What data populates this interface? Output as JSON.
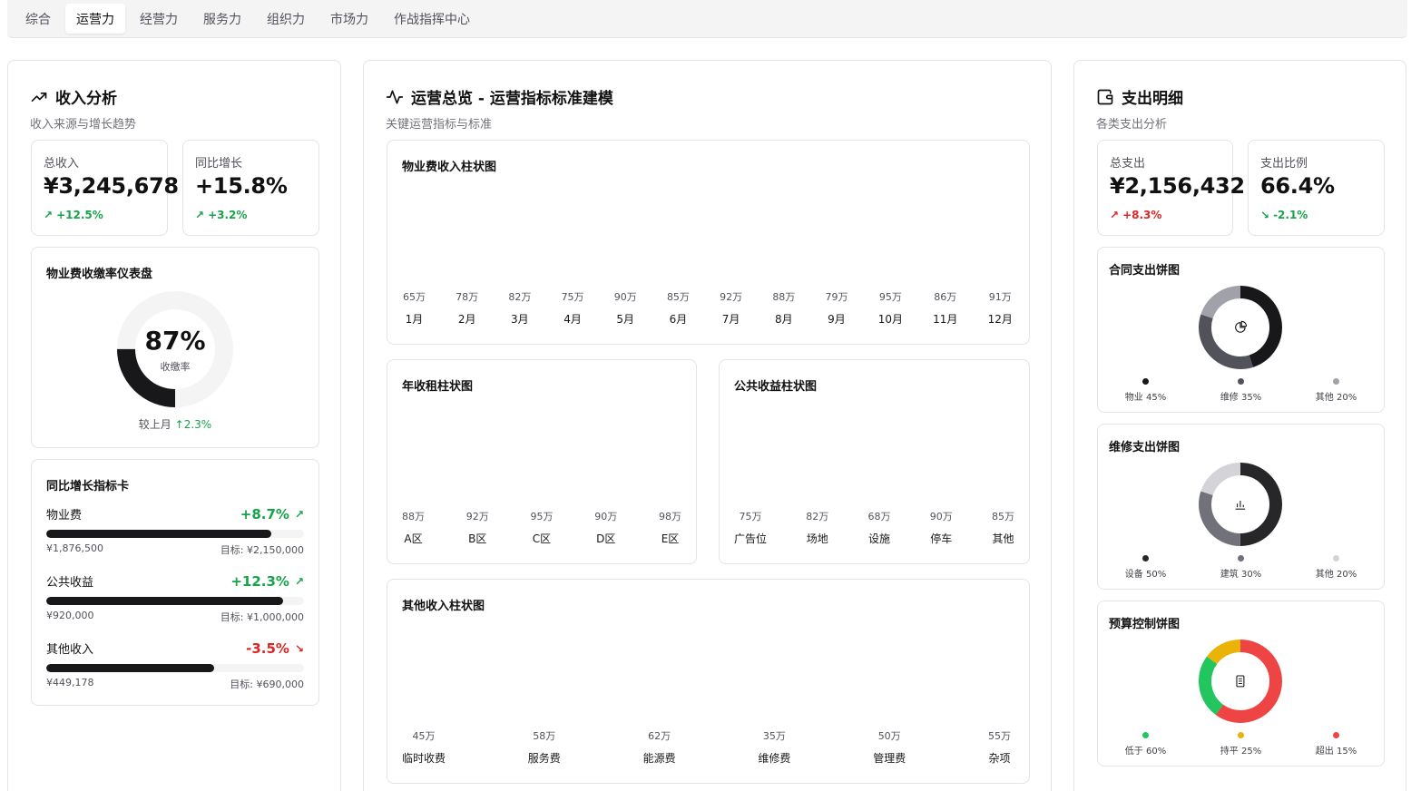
{
  "tabs": [
    "综合",
    "运营力",
    "经营力",
    "服务力",
    "组织力",
    "市场力",
    "作战指挥中心"
  ],
  "active_tab": 1,
  "left": {
    "title": "收入分析",
    "subtitle": "收入来源与增长趋势",
    "total": {
      "label": "总收入",
      "value": "¥3,245,678",
      "delta": "+12.5%"
    },
    "yoy": {
      "label": "同比增长",
      "value": "+15.8%",
      "delta": "+3.2%"
    },
    "gauge": {
      "title": "物业费收缴率仪表盘",
      "value": "87%",
      "label": "收缴率",
      "value_fraction": 0.87,
      "foot_prefix": "较上月",
      "foot_delta": "↑2.3%"
    },
    "growth": {
      "title": "同比增长指标卡",
      "items": [
        {
          "name": "物业费",
          "pct": "+8.7%",
          "dir": "up",
          "actual": "¥1,876,500",
          "target": "目标: ¥2,150,000",
          "ratio": 0.873
        },
        {
          "name": "公共收益",
          "pct": "+12.3%",
          "dir": "up",
          "actual": "¥920,000",
          "target": "目标: ¥1,000,000",
          "ratio": 0.92
        },
        {
          "name": "其他收入",
          "pct": "-3.5%",
          "dir": "down",
          "actual": "¥449,178",
          "target": "目标: ¥690,000",
          "ratio": 0.651
        }
      ]
    }
  },
  "mid": {
    "title": "运营总览 - 运营指标标准建模",
    "subtitle": "关键运营指标与标准",
    "charts": {
      "property": {
        "title": "物业费收入柱状图",
        "values": [
          "65万",
          "78万",
          "82万",
          "75万",
          "90万",
          "85万",
          "92万",
          "88万",
          "79万",
          "95万",
          "86万",
          "91万"
        ],
        "cats": [
          "1月",
          "2月",
          "3月",
          "4月",
          "5月",
          "6月",
          "7月",
          "8月",
          "9月",
          "10月",
          "11月",
          "12月"
        ]
      },
      "rent": {
        "title": "年收租柱状图",
        "values": [
          "88万",
          "92万",
          "95万",
          "90万",
          "98万"
        ],
        "cats": [
          "A区",
          "B区",
          "C区",
          "D区",
          "E区"
        ]
      },
      "public": {
        "title": "公共收益柱状图",
        "values": [
          "75万",
          "82万",
          "68万",
          "90万",
          "85万"
        ],
        "cats": [
          "广告位",
          "场地",
          "设施",
          "停车",
          "其他"
        ]
      },
      "other": {
        "title": "其他收入柱状图",
        "values": [
          "45万",
          "58万",
          "62万",
          "35万",
          "50万",
          "55万"
        ],
        "cats": [
          "临时收费",
          "服务费",
          "能源费",
          "维修费",
          "管理费",
          "杂项"
        ]
      }
    }
  },
  "right": {
    "title": "支出明细",
    "subtitle": "各类支出分析",
    "total": {
      "label": "总支出",
      "value": "¥2,156,432",
      "delta": "+8.3%"
    },
    "ratio": {
      "label": "支出比例",
      "value": "66.4%",
      "delta": "-2.1%"
    },
    "pies": [
      {
        "title": "合同支出饼图",
        "icon": "pie-chart-icon",
        "legend": [
          "物业 45%",
          "维修 35%",
          "其他 20%"
        ],
        "fractions": [
          0.45,
          0.35,
          0.2
        ],
        "colors": [
          "#18181b",
          "#52525b",
          "#a1a1aa"
        ]
      },
      {
        "title": "维修支出饼图",
        "icon": "bar-chart-icon",
        "legend": [
          "设备 50%",
          "建筑 30%",
          "其他 20%"
        ],
        "fractions": [
          0.5,
          0.3,
          0.2
        ],
        "colors": [
          "#27272a",
          "#71717a",
          "#d4d4d8"
        ]
      },
      {
        "title": "预算控制饼图",
        "icon": "document-icon",
        "legend": [
          "低于 60%",
          "持平 25%",
          "超出 15%"
        ],
        "fractions": [
          0.6,
          0.25,
          0.15
        ],
        "colors": [
          "#ef4444",
          "#22c55e",
          "#eab308"
        ],
        "dot_colors": [
          "#22c55e",
          "#eab308",
          "#ef4444"
        ]
      }
    ]
  }
}
